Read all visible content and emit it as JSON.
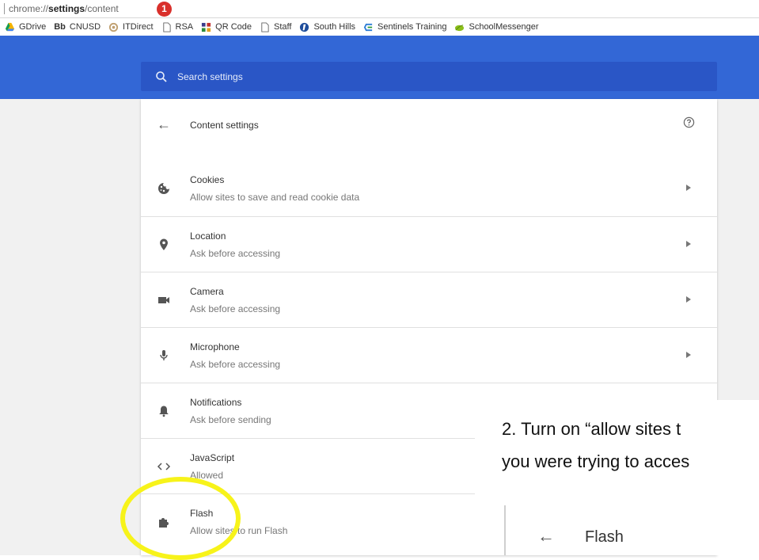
{
  "address_bar": {
    "url_prefix": "chrome://",
    "url_bold": "settings",
    "url_suffix": "/content",
    "badge": "1"
  },
  "bookmarks": [
    {
      "label": "GDrive",
      "icon": "gdrive-icon",
      "color": "#f4b400"
    },
    {
      "label": "CNUSD",
      "icon": "blackboard-icon",
      "prefix": "Bb"
    },
    {
      "label": "ITDirect",
      "icon": "itdirect-icon",
      "color": "#c0a070"
    },
    {
      "label": "RSA",
      "icon": "page-icon"
    },
    {
      "label": "QR Code",
      "icon": "qr-icon",
      "color": "#3a3a8a"
    },
    {
      "label": "Staff",
      "icon": "page-icon"
    },
    {
      "label": "South Hills",
      "icon": "southhills-icon",
      "color": "#1e4d9b"
    },
    {
      "label": "Sentinels Training",
      "icon": "sentinels-icon",
      "color": "#2e7dd6"
    },
    {
      "label": "SchoolMessenger",
      "icon": "leaf-icon",
      "color": "#8bbf1a"
    }
  ],
  "search": {
    "placeholder": "Search settings"
  },
  "content": {
    "title": "Content settings",
    "rows": [
      {
        "title": "Cookies",
        "subtitle": "Allow sites to save and read cookie data",
        "icon": "cookie-icon"
      },
      {
        "title": "Location",
        "subtitle": "Ask before accessing",
        "icon": "location-icon"
      },
      {
        "title": "Camera",
        "subtitle": "Ask before accessing",
        "icon": "camera-icon"
      },
      {
        "title": "Microphone",
        "subtitle": "Ask before accessing",
        "icon": "microphone-icon"
      },
      {
        "title": "Notifications",
        "subtitle": "Ask before sending",
        "icon": "bell-icon"
      },
      {
        "title": "JavaScript",
        "subtitle": "Allowed",
        "icon": "code-icon"
      },
      {
        "title": "Flash",
        "subtitle": "Allow sites to run Flash",
        "icon": "puzzle-icon"
      }
    ]
  },
  "overlay": {
    "line1": "2. Turn on “allow sites t",
    "line2": "you were trying to acces",
    "panel_title": "Flash"
  },
  "colors": {
    "header": "#3367d6",
    "search": "#2a56c6",
    "highlight": "#f7f31a",
    "badge": "#d9302b"
  }
}
